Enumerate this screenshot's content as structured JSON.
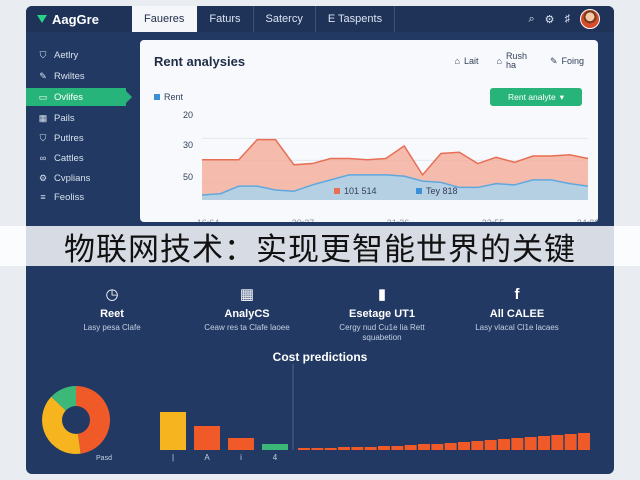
{
  "app": {
    "brand": "AagGre"
  },
  "tabs": [
    {
      "label": "Faueres",
      "active": true
    },
    {
      "label": "Faturs",
      "active": false
    },
    {
      "label": "Satercy",
      "active": false
    },
    {
      "label": "E Taspents",
      "active": false
    }
  ],
  "sidebar": {
    "items": [
      {
        "label": "Aetlry",
        "icon": "shield-icon"
      },
      {
        "label": "Rwiltes",
        "icon": "pencil-icon"
      },
      {
        "label": "Ovlifes",
        "icon": "box-icon",
        "active": true
      },
      {
        "label": "Pails",
        "icon": "grid-icon"
      },
      {
        "label": "Putlres",
        "icon": "shield-icon"
      },
      {
        "label": "Cattles",
        "icon": "link-icon"
      },
      {
        "label": "Cvplians",
        "icon": "gear-icon"
      },
      {
        "label": "Feoliss",
        "icon": "list-icon"
      }
    ]
  },
  "card": {
    "title": "Rent analysies",
    "actions": [
      {
        "label": "Lait",
        "icon": "home-icon"
      },
      {
        "label": "Rush ha",
        "icon": "home-icon"
      },
      {
        "label": "Foing",
        "icon": "pencil-icon"
      }
    ],
    "legend_label": "Rent",
    "button_label": "Rent analyte",
    "series_labels": [
      "101 514",
      "Tey 818"
    ]
  },
  "chart_data": {
    "type": "area",
    "x_tick_labels": [
      "16:64",
      "20:27",
      "21:36",
      "23:55",
      "24:88"
    ],
    "y_tick_labels": [
      "20",
      "30",
      "50"
    ],
    "series": [
      {
        "name": "101 514",
        "color": "#f4a28c",
        "values": [
          32,
          32,
          32,
          48,
          48,
          28,
          29,
          33,
          33,
          32,
          33,
          43,
          20,
          37,
          38,
          29,
          34,
          30,
          35,
          35,
          36,
          33
        ]
      },
      {
        "name": "Tey 818",
        "color": "#a9d2ec",
        "values": [
          4,
          5,
          11,
          11,
          8,
          7,
          12,
          16,
          20,
          20,
          20,
          19,
          15,
          14,
          10,
          10,
          13,
          12,
          16,
          16,
          13,
          11
        ]
      }
    ],
    "ylim": [
      0,
      70
    ]
  },
  "banner": {
    "text": "物联网技术：实现更智能世界的关键"
  },
  "features": [
    {
      "title": "Reet",
      "desc": "Lasy pesa Clafe",
      "icon": "clock-icon"
    },
    {
      "title": "AnalyCS",
      "desc": "Ceaw res ta Clafe laoee",
      "icon": "building-icon"
    },
    {
      "title": "Esetage UT1",
      "desc": "Cergy nud Cu1e lia Rett squabetion",
      "icon": "chart-icon"
    },
    {
      "title": "All CALEE",
      "desc": "Lasy vlacal Cl1e lacaes",
      "icon": "facebook-icon"
    }
  ],
  "cost": {
    "title": "Cost predictions",
    "pie_label": "Pasd",
    "pie": [
      {
        "value": 0.55,
        "color": "#f05a28"
      },
      {
        "value": 0.45,
        "color": "#f6b51e"
      },
      {
        "value": 0.15,
        "color": "#3cb878"
      }
    ],
    "bars": [
      {
        "value": 38,
        "color": "#f6b51e",
        "label": "|"
      },
      {
        "value": 24,
        "color": "#f05a28",
        "label": "A"
      },
      {
        "value": 12,
        "color": "#f05a28",
        "label": "i"
      },
      {
        "value": 6,
        "color": "#3cb878",
        "label": "4"
      }
    ],
    "bars2": [
      {
        "value": 2,
        "label": ""
      },
      {
        "value": 2,
        "label": ""
      },
      {
        "value": 2,
        "label": ""
      },
      {
        "value": 3,
        "label": ""
      },
      {
        "value": 3,
        "label": ""
      },
      {
        "value": 3,
        "label": ""
      },
      {
        "value": 4,
        "label": ""
      },
      {
        "value": 4,
        "label": ""
      },
      {
        "value": 5,
        "label": ""
      },
      {
        "value": 6,
        "label": ""
      },
      {
        "value": 6,
        "label": ""
      },
      {
        "value": 7,
        "label": ""
      },
      {
        "value": 8,
        "label": ""
      },
      {
        "value": 9,
        "label": ""
      },
      {
        "value": 10,
        "label": ""
      },
      {
        "value": 11,
        "label": ""
      },
      {
        "value": 12,
        "label": ""
      },
      {
        "value": 13,
        "label": ""
      },
      {
        "value": 14,
        "label": ""
      },
      {
        "value": 15,
        "label": ""
      },
      {
        "value": 16,
        "label": ""
      },
      {
        "value": 17,
        "label": ""
      }
    ],
    "bar2_color": "#f05a28"
  }
}
